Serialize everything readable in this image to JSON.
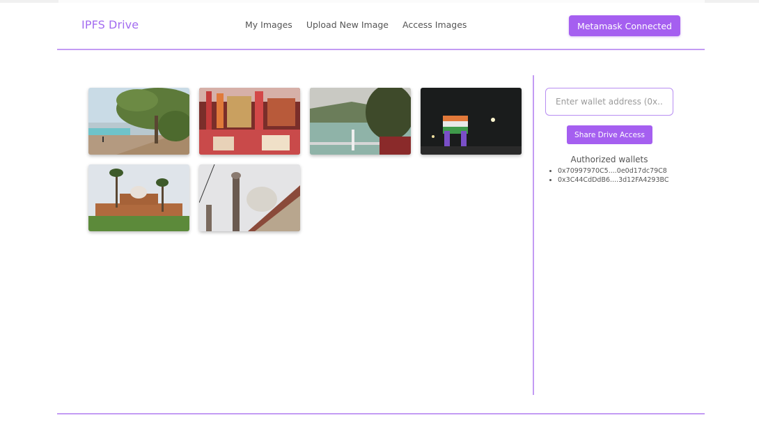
{
  "brand": "IPFS Drive",
  "nav": {
    "links": [
      "My Images",
      "Upload New Image",
      "Access Images"
    ],
    "connect_label": "Metamask Connected"
  },
  "gallery": {
    "images": [
      {
        "subject": "lakeside-trees"
      },
      {
        "subject": "market-stall"
      },
      {
        "subject": "river-bridge"
      },
      {
        "subject": "india-gate-night"
      },
      {
        "subject": "humayun-tomb"
      },
      {
        "subject": "mosque-minaret"
      }
    ]
  },
  "share": {
    "placeholder": "Enter wallet address (0x...)",
    "button_label": "Share Drive Access",
    "authorized_title": "Authorized wallets",
    "wallets": [
      "0x70997970C5....0e0d17dc79C8",
      "0x3C44CdDdB6....3d12FA4293BC"
    ]
  },
  "footer": "",
  "colors": {
    "accent": "#a55ff0",
    "divider": "#c39bf4",
    "brand": "#a36cf0"
  }
}
